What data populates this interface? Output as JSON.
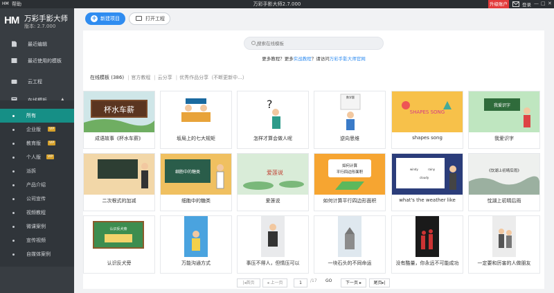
{
  "titlebar": {
    "menu": "帮助",
    "title": "万彩手影大师2.7.000",
    "upgrade": "升级账户",
    "login": "登录",
    "win": [
      "—",
      "□",
      "✕"
    ]
  },
  "brand": {
    "logo": "HM",
    "name": "万彩手影大师",
    "version": "版本: 2.7.000"
  },
  "sidebar": {
    "items": [
      {
        "label": "最近编辑",
        "icon": "document-icon"
      },
      {
        "label": "最近使用的模板",
        "icon": "clock-icon"
      },
      {
        "label": "云工程",
        "icon": "cloud-icon"
      },
      {
        "label": "在线模板",
        "icon": "template-icon"
      }
    ],
    "sub": [
      {
        "label": "所有",
        "vip": ""
      },
      {
        "label": "企业版",
        "vip": "VIP"
      },
      {
        "label": "教育版",
        "vip": "VIP"
      },
      {
        "label": "个人版",
        "vip": "VIP"
      },
      {
        "label": "派拆",
        "vip": ""
      },
      {
        "label": "产品介绍",
        "vip": ""
      },
      {
        "label": "公司宣传",
        "vip": ""
      },
      {
        "label": "视频教程",
        "vip": ""
      },
      {
        "label": "微课案例",
        "vip": ""
      },
      {
        "label": "宣传视频",
        "vip": ""
      },
      {
        "label": "自媒体案例",
        "vip": ""
      }
    ]
  },
  "toolbar": {
    "new_label": "新建项目",
    "open_label": "打开工程"
  },
  "search": {
    "placeholder": "搜索在线模板"
  },
  "more": {
    "prefix": "更多教程？更多",
    "link1": "实战教程",
    "middle": "？请访问",
    "link2": "万彩手影大师官网"
  },
  "tabs": [
    {
      "label": "在线模板 (386)"
    },
    {
      "label": "官方教程"
    },
    {
      "label": "云分享"
    },
    {
      "label": "优秀作品分享（不断更新中...）"
    }
  ],
  "cards": [
    {
      "caption": "成语故事《杯水车薪》",
      "thumb_text": "杯水车薪"
    },
    {
      "caption": "坂局上的七大规矩",
      "thumb_text": ""
    },
    {
      "caption": "怎样才算会做人呢",
      "thumb_text": "?"
    },
    {
      "caption": "逆向思维",
      "thumb_text": "数学题"
    },
    {
      "caption": "shapes song",
      "thumb_text": "SHAPES SONG"
    },
    {
      "caption": "我爱识字",
      "thumb_text": "我爱识字"
    },
    {
      "caption": "二次根式的加减",
      "thumb_text": ""
    },
    {
      "caption": "细胞中的糖类",
      "thumb_text": "细胞中的糖类"
    },
    {
      "caption": "爱莲说",
      "thumb_text": "爱莲说"
    },
    {
      "caption": "如何计算平行四边形面积",
      "thumb_text": "如何计算 平行四边形面积"
    },
    {
      "caption": "what's the weather like",
      "thumb_text": "windy rainy cloudy"
    },
    {
      "caption": "忱湖上初晴后雨",
      "thumb_text": "《饮湖上初晴后雨》"
    },
    {
      "caption": "认识反犬旁",
      "thumb_text": "认识反犬旁"
    },
    {
      "caption": "万能沟通方式",
      "thumb_text": ""
    },
    {
      "caption": "事压不得人，但情压可以",
      "thumb_text": ""
    },
    {
      "caption": "一块石头的不同命运",
      "thumb_text": ""
    },
    {
      "caption": "没有酷量，你永远不可能成功",
      "thumb_text": ""
    },
    {
      "caption": "一定要和厉害的人做朋友",
      "thumb_text": ""
    }
  ],
  "pager": {
    "first": "首页",
    "prev": "上一页",
    "page": "1",
    "total": "/17",
    "go": "GO",
    "next": "下一页",
    "last": "尾页"
  },
  "colors": {
    "sidebar": "#383d42",
    "active": "#168f86",
    "accent": "#2f8cf0",
    "upgrade": "#e23b3b",
    "vip": "#d6a12b"
  }
}
